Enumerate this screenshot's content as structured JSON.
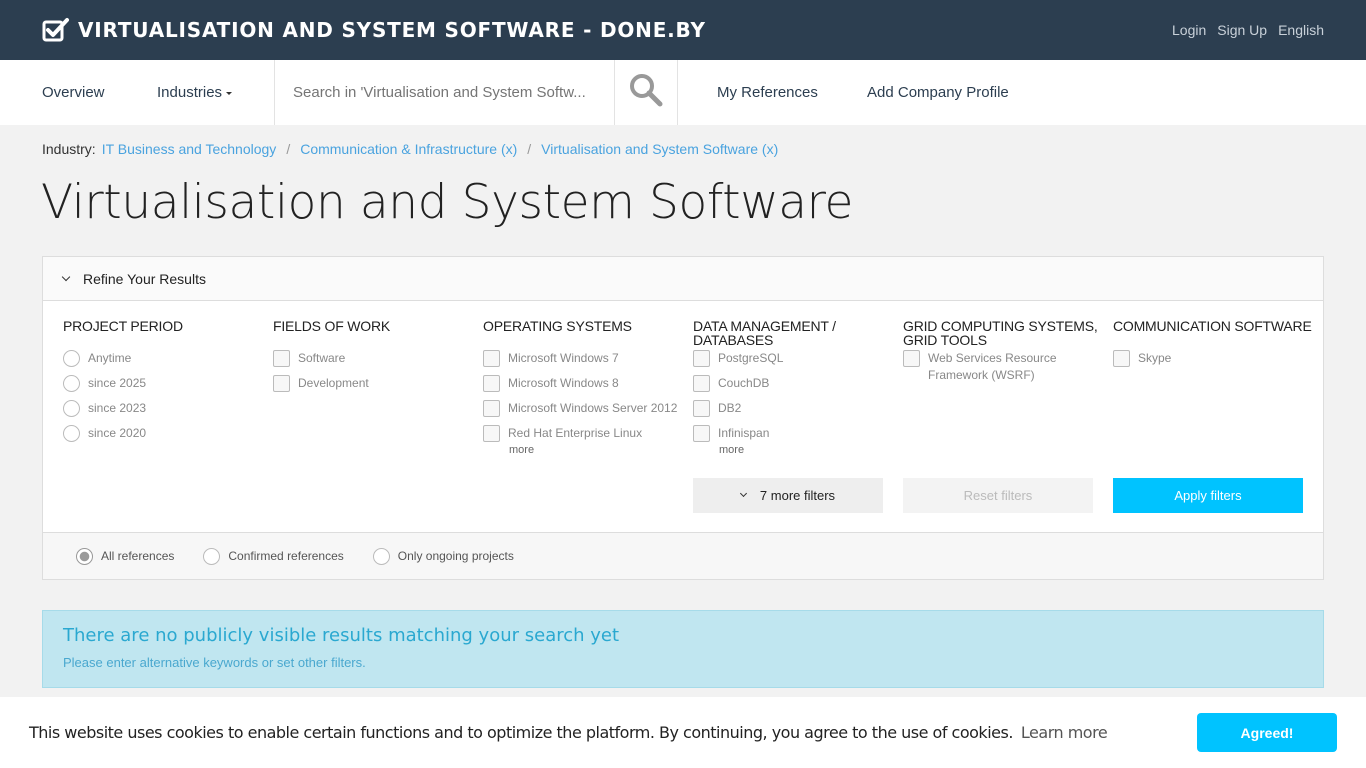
{
  "header": {
    "brand": "VIRTUALISATION AND SYSTEM SOFTWARE - DONE.BY",
    "links": [
      "Login",
      "Sign Up",
      "English"
    ]
  },
  "nav": {
    "overview": "Overview",
    "industries": "Industries",
    "search_placeholder": "Search in 'Virtualisation and System Softw...",
    "my_references": "My References",
    "add_company": "Add Company Profile"
  },
  "breadcrumb": {
    "label": "Industry:",
    "items": [
      "IT Business and Technology",
      "Communication & Infrastructure (x)",
      "Virtualisation and System Software (x)"
    ],
    "separator": "/"
  },
  "page_title": "Virtualisation and System Software",
  "filters": {
    "toggle_label": "Refine Your Results",
    "columns": [
      {
        "title": "PROJECT PERIOD",
        "type": "radio",
        "options": [
          "Anytime",
          "since 2025",
          "since 2023",
          "since 2020"
        ]
      },
      {
        "title": "FIELDS OF WORK",
        "type": "checkbox",
        "options": [
          "Software",
          "Development"
        ]
      },
      {
        "title": "OPERATING SYSTEMS",
        "type": "checkbox",
        "options": [
          "Microsoft Windows 7",
          "Microsoft Windows 8",
          "Microsoft Windows Server 2012",
          "Red Hat Enterprise Linux"
        ],
        "more": "more"
      },
      {
        "title": "DATA MANAGEMENT / DATABASES",
        "type": "checkbox",
        "options": [
          "PostgreSQL",
          "CouchDB",
          "DB2",
          "Infinispan"
        ],
        "more": "more"
      },
      {
        "title": "GRID COMPUTING SYSTEMS, GRID TOOLS",
        "type": "checkbox",
        "options": [
          "Web Services Resource Framework (WSRF)"
        ]
      },
      {
        "title": "COMMUNICATION SOFTWARE",
        "type": "checkbox",
        "options": [
          "Skype"
        ]
      }
    ],
    "more_filters": "7 more filters",
    "reset": "Reset filters",
    "apply": "Apply filters",
    "reference_types": [
      "All references",
      "Confirmed references",
      "Only ongoing projects"
    ],
    "selected_reference_type": "All references"
  },
  "alert": {
    "title": "There are no publicly visible results matching your search yet",
    "text": "Please enter alternative keywords or set other filters."
  },
  "cookie": {
    "text": "This website uses cookies to enable certain functions and to optimize the platform. By continuing, you agree to the use of cookies.",
    "learn_more": "Learn more",
    "button": "Agreed!"
  },
  "colors": {
    "topbar": "#2c3e50",
    "accent": "#00c3ff",
    "link": "#4aa3df",
    "alert_bg": "#c0e6f0"
  }
}
